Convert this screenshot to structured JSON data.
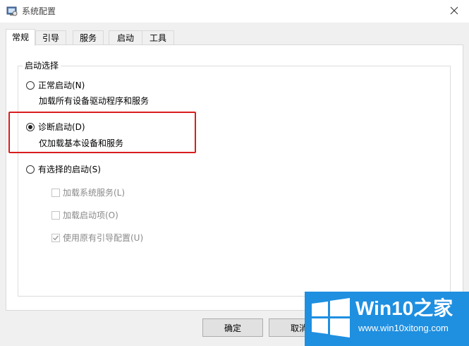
{
  "window": {
    "title": "系统配置"
  },
  "tabs": [
    {
      "label": "常规",
      "active": true
    },
    {
      "label": "引导",
      "active": false
    },
    {
      "label": "服务",
      "active": false
    },
    {
      "label": "启动",
      "active": false
    },
    {
      "label": "工具",
      "active": false
    }
  ],
  "startup": {
    "group_title": "启动选择",
    "normal": {
      "label": "正常启动(N)",
      "desc": "加载所有设备驱动程序和服务",
      "checked": false
    },
    "diagnostic": {
      "label": "诊断启动(D)",
      "desc": "仅加载基本设备和服务",
      "checked": true
    },
    "selective": {
      "label": "有选择的启动(S)",
      "checked": false,
      "options": [
        {
          "label": "加载系统服务(L)",
          "checked": false,
          "enabled": false
        },
        {
          "label": "加载启动项(O)",
          "checked": false,
          "enabled": false
        },
        {
          "label": "使用原有引导配置(U)",
          "checked": true,
          "enabled": false
        }
      ]
    }
  },
  "buttons": {
    "ok": "确定",
    "cancel": "取消"
  },
  "watermark": {
    "brand": "Win10之家",
    "url": "www.win10xitong.com"
  },
  "colors": {
    "highlight": "#d81e1e",
    "watermark_bg": "#1f8fe0"
  }
}
